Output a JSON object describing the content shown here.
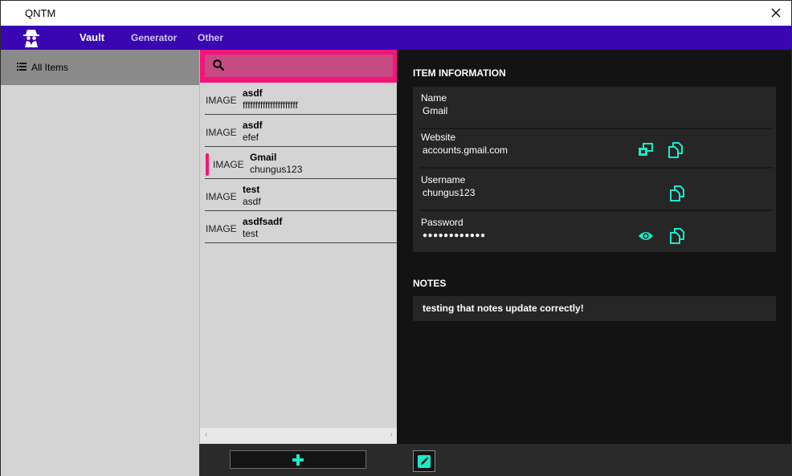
{
  "window": {
    "title": "QNTM"
  },
  "nav": {
    "tabs": [
      {
        "label": "Vault",
        "active": true
      },
      {
        "label": "Generator",
        "active": false
      },
      {
        "label": "Other",
        "active": false
      }
    ],
    "logo_icon": "spy-icon"
  },
  "sidebar": {
    "items": [
      {
        "label": "All Items",
        "icon": "list-icon",
        "selected": true
      }
    ]
  },
  "search": {
    "value": "",
    "placeholder": ""
  },
  "items": [
    {
      "image": "IMAGE",
      "name": "asdf",
      "subtitle": "ffffffffffffffffffffff",
      "selected": false
    },
    {
      "image": "IMAGE",
      "name": "asdf",
      "subtitle": "efef",
      "selected": false
    },
    {
      "image": "IMAGE",
      "name": "Gmail",
      "subtitle": "chungus123",
      "selected": true
    },
    {
      "image": "IMAGE",
      "name": "test",
      "subtitle": "asdf",
      "selected": false
    },
    {
      "image": "IMAGE",
      "name": "asdfsadf",
      "subtitle": "test",
      "selected": false
    }
  ],
  "detail": {
    "section_title": "ITEM INFORMATION",
    "fields": {
      "name": {
        "label": "Name",
        "value": "Gmail"
      },
      "website": {
        "label": "Website",
        "value": "accounts.gmail.com"
      },
      "username": {
        "label": "Username",
        "value": "chungus123"
      },
      "password": {
        "label": "Password",
        "value": "●●●●●●●●●●●●"
      }
    },
    "notes_title": "NOTES",
    "notes": "testing that notes update correctly!"
  },
  "colors": {
    "nav_bg": "#3a06b2",
    "accent_pink": "#f4147b",
    "icon_teal": "#1de9c8",
    "detail_bg": "#131313",
    "card_bg": "#262626"
  }
}
